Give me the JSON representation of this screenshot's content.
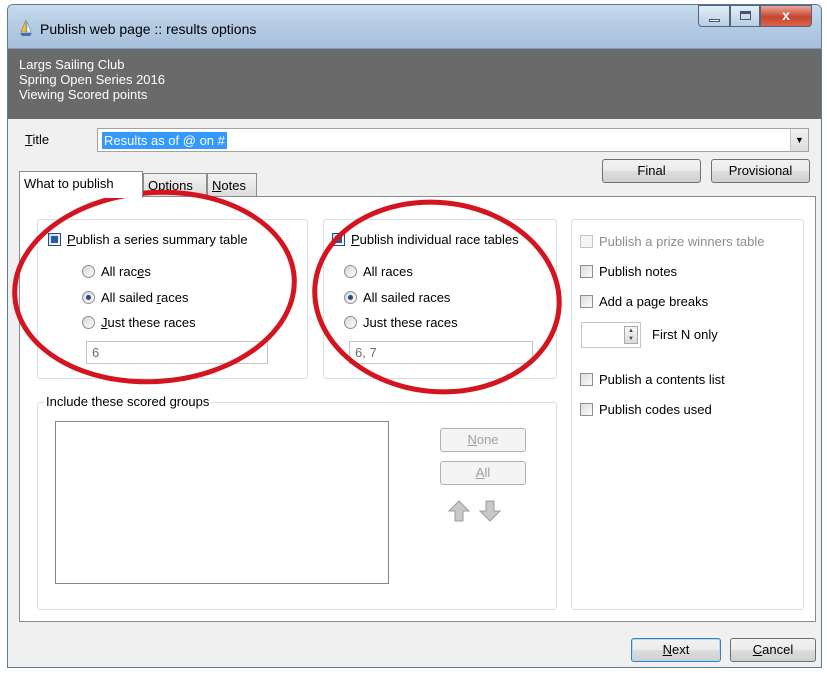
{
  "window": {
    "title": "Publish web page :: results options"
  },
  "header": {
    "line1": "Largs Sailing Club",
    "line2": "Spring Open Series 2016",
    "line3": "Viewing Scored points"
  },
  "title_field": {
    "label_prefix": "T",
    "label_rest": "itle",
    "value": "Results as of @ on #"
  },
  "buttons": {
    "final": "Final",
    "provisional": "Provisional",
    "none_prefix": "N",
    "none_rest": "one",
    "all_prefix": "A",
    "all_rest": "ll",
    "next_prefix": "N",
    "next_rest": "ext",
    "cancel_prefix": "C",
    "cancel_rest": "ancel"
  },
  "tabs": [
    {
      "label_prefix": "",
      "label_u": "",
      "label_rest": "What to publish"
    },
    {
      "label_prefix": "",
      "label_u": "O",
      "label_rest": "ptions"
    },
    {
      "label_prefix": "",
      "label_u": "N",
      "label_rest": "otes"
    }
  ],
  "series_group": {
    "checkbox_label_u": "P",
    "checkbox_label_rest": "ublish a series summary table",
    "checked": true,
    "options": [
      {
        "label_pre": "All rac",
        "label_u": "e",
        "label_post": "s",
        "selected": false
      },
      {
        "label_pre": "All sailed ",
        "label_u": "r",
        "label_post": "aces",
        "selected": true
      },
      {
        "label_pre": "",
        "label_u": "J",
        "label_post": "ust these races",
        "selected": false
      }
    ],
    "races_value": "6"
  },
  "individual_group": {
    "checkbox_label_u": "P",
    "checkbox_label_rest": "ublish individual race tables",
    "checked": true,
    "options": [
      {
        "label_pre": "All races",
        "label_u": "",
        "label_post": "",
        "selected": false
      },
      {
        "label_pre": "All sailed races",
        "label_u": "",
        "label_post": "",
        "selected": true
      },
      {
        "label_pre": "Just these races",
        "label_u": "",
        "label_post": "",
        "selected": false
      }
    ],
    "races_value": "6, 7"
  },
  "groups_box": {
    "title": "Include these scored groups"
  },
  "right_options": {
    "prize_table": {
      "label": "Publish a prize winners table",
      "checked": false,
      "enabled": false
    },
    "notes": {
      "label": "Publish notes",
      "checked": false
    },
    "page_breaks": {
      "label": "Add a page breaks",
      "checked": false
    },
    "first_n": {
      "label": "First N only",
      "value": ""
    },
    "contents": {
      "label": "Publish a contents list",
      "checked": false
    },
    "codes": {
      "label": "Publish codes used",
      "checked": false
    }
  },
  "icons": {
    "app": "sailboat-icon",
    "up": "up-arrow-icon",
    "down": "down-arrow-icon"
  },
  "colors": {
    "header_band": "#6a6a6a",
    "selection": "#3399ff",
    "annotation": "#d4141f"
  }
}
